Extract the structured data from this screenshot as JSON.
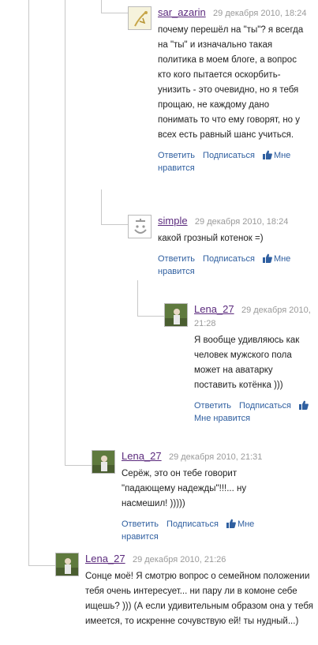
{
  "comments": [
    {
      "author": "sar_azarin",
      "date": "29 декабря 2010, 18:24",
      "text": "почему перешёл на \"ты\"? я всегда на \"ты\" и изначально такая политика в моем блоге, а вопрос кто кого пытается оскорбить-унизить - это очевидно, но я тебя прощаю, не каждому дано понимать то что ему говорят, но у всех есть равный шанс учиться.",
      "reply": "Ответить",
      "subscribe": "Подписаться",
      "like": "Мне нравится"
    },
    {
      "author": "simple",
      "date": "29 декабря 2010, 18:24",
      "text": "какой грозный котенок =)",
      "reply": "Ответить",
      "subscribe": "Подписаться",
      "like": "Мне нравится"
    },
    {
      "author": "Lena_27",
      "date": "29 декабря 2010, 21:28",
      "text": "Я вообще удивляюсь как человек мужского пола может на аватарку поставить котёнка )))",
      "reply": "Ответить",
      "subscribe": "Подписаться",
      "like": "Мне нравится"
    },
    {
      "author": "Lena_27",
      "date": "29 декабря 2010, 21:31",
      "text": "Серёж, это он тебе говорит \"падающему надежды\"!!!... ну насмешил! )))))",
      "reply": "Ответить",
      "subscribe": "Подписаться",
      "like": "Мне нравится"
    },
    {
      "author": "Lena_27",
      "date": "29 декабря 2010, 21:26",
      "text": "Сонце моё! Я смотрю вопрос о семейном положении тебя очень интересует... ни пару ли в комоне себе ищешь? ))) (А если удивительным образом она у тебя имеется, то искренне сочувствую ей! ты нудный...)"
    }
  ],
  "colors": {
    "author": "#5b2a7d",
    "link": "#2f5fa0",
    "date": "#9a9a9a",
    "thread_line": "#c8c8c8"
  }
}
